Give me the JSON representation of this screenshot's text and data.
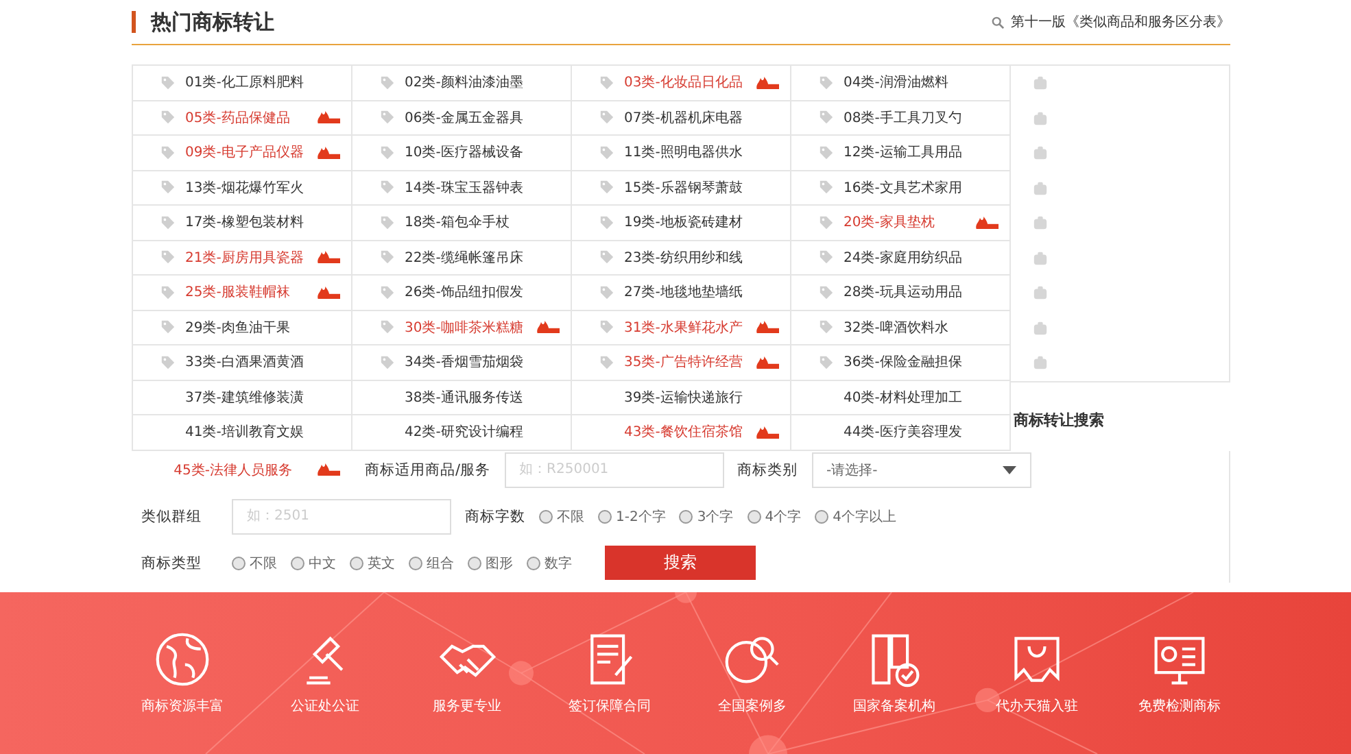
{
  "header": {
    "title": "热门商标转让",
    "link": "第十一版《类似商品和服务区分表》"
  },
  "categories": [
    {
      "label": "01类-化工原料肥料",
      "hot": false,
      "icon": true
    },
    {
      "label": "02类-颜料油漆油墨",
      "hot": false,
      "icon": true
    },
    {
      "label": "03类-化妆品日化品",
      "hot": true,
      "icon": true
    },
    {
      "label": "04类-润滑油燃料",
      "hot": false,
      "icon": true
    },
    {
      "label": "05类-药品保健品",
      "hot": true,
      "icon": true
    },
    {
      "label": "06类-金属五金器具",
      "hot": false,
      "icon": true
    },
    {
      "label": "07类-机器机床电器",
      "hot": false,
      "icon": true
    },
    {
      "label": "08类-手工具刀叉勺",
      "hot": false,
      "icon": true
    },
    {
      "label": "09类-电子产品仪器",
      "hot": true,
      "icon": true
    },
    {
      "label": "10类-医疗器械设备",
      "hot": false,
      "icon": true
    },
    {
      "label": "11类-照明电器供水",
      "hot": false,
      "icon": true
    },
    {
      "label": "12类-运输工具用品",
      "hot": false,
      "icon": true
    },
    {
      "label": "13类-烟花爆竹军火",
      "hot": false,
      "icon": true
    },
    {
      "label": "14类-珠宝玉器钟表",
      "hot": false,
      "icon": true
    },
    {
      "label": "15类-乐器钢琴萧鼓",
      "hot": false,
      "icon": true
    },
    {
      "label": "16类-文具艺术家用",
      "hot": false,
      "icon": true
    },
    {
      "label": "17类-橡塑包装材料",
      "hot": false,
      "icon": true
    },
    {
      "label": "18类-箱包伞手杖",
      "hot": false,
      "icon": true
    },
    {
      "label": "19类-地板瓷砖建材",
      "hot": false,
      "icon": true
    },
    {
      "label": "20类-家具垫枕",
      "hot": true,
      "icon": true
    },
    {
      "label": "21类-厨房用具瓷器",
      "hot": true,
      "icon": true
    },
    {
      "label": "22类-缆绳帐篷吊床",
      "hot": false,
      "icon": true
    },
    {
      "label": "23类-纺织用纱和线",
      "hot": false,
      "icon": true
    },
    {
      "label": "24类-家庭用纺织品",
      "hot": false,
      "icon": true
    },
    {
      "label": "25类-服装鞋帽袜",
      "hot": true,
      "icon": true
    },
    {
      "label": "26类-饰品纽扣假发",
      "hot": false,
      "icon": true
    },
    {
      "label": "27类-地毯地垫墙纸",
      "hot": false,
      "icon": true
    },
    {
      "label": "28类-玩具运动用品",
      "hot": false,
      "icon": true
    },
    {
      "label": "29类-肉鱼油干果",
      "hot": false,
      "icon": true
    },
    {
      "label": "30类-咖啡茶米糕糖",
      "hot": true,
      "icon": true
    },
    {
      "label": "31类-水果鲜花水产",
      "hot": true,
      "icon": true
    },
    {
      "label": "32类-啤酒饮料水",
      "hot": false,
      "icon": true
    },
    {
      "label": "33类-白酒果酒黄酒",
      "hot": false,
      "icon": true
    },
    {
      "label": "34类-香烟雪茄烟袋",
      "hot": false,
      "icon": true
    },
    {
      "label": "35类-广告特许经营",
      "hot": true,
      "icon": true
    },
    {
      "label": "36类-保险金融担保",
      "hot": false,
      "icon": true
    },
    {
      "label": "37类-建筑维修装潢",
      "hot": false,
      "icon": false
    },
    {
      "label": "38类-通讯服务传送",
      "hot": false,
      "icon": false
    },
    {
      "label": "39类-运输快递旅行",
      "hot": false,
      "icon": false
    },
    {
      "label": "40类-材料处理加工",
      "hot": false,
      "icon": false
    },
    {
      "label": "41类-培训教育文娱",
      "hot": false,
      "icon": false
    },
    {
      "label": "42类-研究设计编程",
      "hot": false,
      "icon": false
    },
    {
      "label": "43类-餐饮住宿茶馆",
      "hot": true,
      "icon": false
    },
    {
      "label": "44类-医疗美容理发",
      "hot": false,
      "icon": false
    },
    {
      "label": "45类-法律人员服务",
      "hot": true,
      "icon": false
    }
  ],
  "search": {
    "title": "商标转让搜索",
    "goods_label": "商标适用商品/服务",
    "goods_placeholder": "如：R250001",
    "class_label": "商标类别",
    "class_value": "-请选择-",
    "group_label": "类似群组",
    "group_placeholder": "如：2501",
    "length_label": "商标字数",
    "length_options": [
      {
        "label": "不限",
        "selected": false
      },
      {
        "label": "1-2个字",
        "selected": false
      },
      {
        "label": "3个字",
        "selected": false
      },
      {
        "label": "4个字",
        "selected": false
      },
      {
        "label": "4个字以上",
        "selected": false
      }
    ],
    "type_label": "商标类型",
    "type_options": [
      {
        "label": "不限",
        "selected": false
      },
      {
        "label": "中文",
        "selected": false
      },
      {
        "label": "英文",
        "selected": false
      },
      {
        "label": "组合",
        "selected": false
      },
      {
        "label": "图形",
        "selected": false
      },
      {
        "label": "数字",
        "selected": false
      }
    ],
    "button": "搜索"
  },
  "features": [
    {
      "kind": "globe",
      "label": "商标资源丰富"
    },
    {
      "kind": "gavel",
      "label": "公证处公证"
    },
    {
      "kind": "handshake",
      "label": "服务更专业"
    },
    {
      "kind": "contract",
      "label": "签订保障合同"
    },
    {
      "kind": "globe-search",
      "label": "全国案例多"
    },
    {
      "kind": "binders",
      "label": "国家备案机构"
    },
    {
      "kind": "bag",
      "label": "代办天猫入驻"
    },
    {
      "kind": "monitor",
      "label": "免费检测商标"
    }
  ]
}
